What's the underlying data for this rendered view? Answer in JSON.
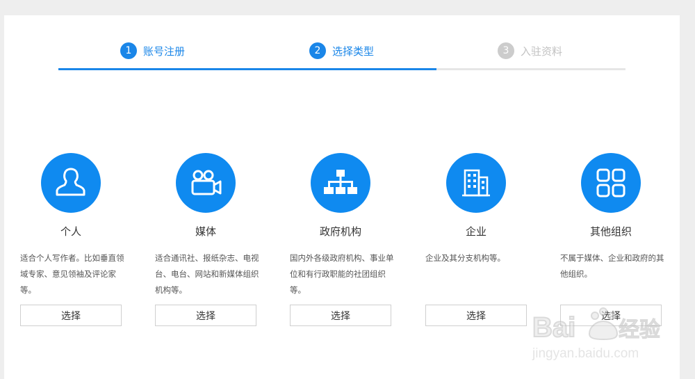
{
  "steps": [
    {
      "num": "1",
      "label": "账号注册",
      "state": "done"
    },
    {
      "num": "2",
      "label": "选择类型",
      "state": "current"
    },
    {
      "num": "3",
      "label": "入驻资料",
      "state": "pending"
    }
  ],
  "progress": {
    "completed_fraction": 0.667
  },
  "colors": {
    "accent": "#1a86e8",
    "icon_bg": "#0f8af0",
    "inactive": "#cccccc"
  },
  "cards": [
    {
      "icon": "person-icon",
      "title": "个人",
      "desc": "适合个人写作者。比如垂直领域专家、意见领袖及评论家等。",
      "button": "选择"
    },
    {
      "icon": "video-camera-icon",
      "title": "媒体",
      "desc": "适合通讯社、报纸杂志、电视台、电台、网站和新媒体组织机构等。",
      "button": "选择"
    },
    {
      "icon": "org-chart-icon",
      "title": "政府机构",
      "desc": "国内外各级政府机构、事业单位和有行政职能的社团组织等。",
      "button": "选择"
    },
    {
      "icon": "building-icon",
      "title": "企业",
      "desc": "企业及其分支机构等。",
      "button": "选择"
    },
    {
      "icon": "grid-icon",
      "title": "其他组织",
      "desc": "不属于媒体、企业和政府的其他组织。",
      "button": "选择"
    }
  ],
  "watermark": {
    "brand": "Bai du 经验",
    "url": "jingyan.baidu.com"
  }
}
